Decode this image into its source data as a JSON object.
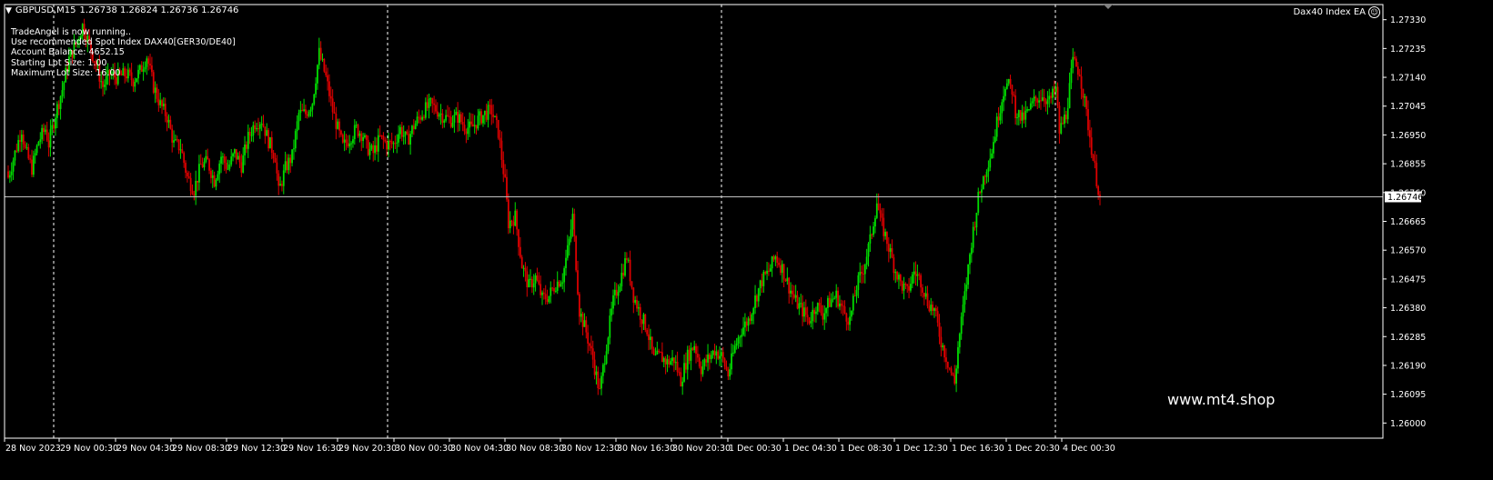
{
  "header": {
    "symbol": "GBPUSD,M15",
    "ohlc": "1.26738 1.26824 1.26736 1.26746",
    "ea_name": "Dax40 Index EA"
  },
  "info_panel": [
    "TradeAngel is now running..",
    "Use recommended Spot Index DAX40[GER30/DE40]",
    "Account Balance: 4652.15",
    "Starting Lot Size: 1.00",
    "Maximum Lot Size: 16.00"
  ],
  "watermark": "www.mt4.shop",
  "colors": {
    "background": "#000000",
    "bull": "#00dd00",
    "bear": "#dd0000",
    "grid": "#ffffff",
    "axis_text": "#ffffff",
    "price_line": "#c0c0c0"
  },
  "chart_data": {
    "type": "candlestick",
    "symbol": "GBPUSD",
    "timeframe": "M15",
    "current_price": 1.26746,
    "current_price_label": "1.26746",
    "ylim": [
      1.2595,
      1.2738
    ],
    "y_ticks": [
      "1.27330",
      "1.27235",
      "1.27140",
      "1.27045",
      "1.26950",
      "1.26855",
      "1.26760",
      "1.26665",
      "1.26570",
      "1.26475",
      "1.26380",
      "1.26285",
      "1.26190",
      "1.26095",
      "1.26000"
    ],
    "x_tick_labels": [
      "28 Nov 2023",
      "29 Nov 00:30",
      "29 Nov 04:30",
      "29 Nov 08:30",
      "29 Nov 12:30",
      "29 Nov 16:30",
      "29 Nov 20:30",
      "30 Nov 00:30",
      "30 Nov 04:30",
      "30 Nov 08:30",
      "30 Nov 12:30",
      "30 Nov 16:30",
      "30 Nov 20:30",
      "1 Dec 00:30",
      "1 Dec 04:30",
      "1 Dec 08:30",
      "1 Dec 12:30",
      "1 Dec 16:30",
      "1 Dec 20:30",
      "4 Dec 00:30"
    ],
    "day_separators": [
      "29 Nov",
      "30 Nov",
      "1 Dec",
      "4 Dec"
    ],
    "close_path": [
      [
        0,
        1.2681
      ],
      [
        4,
        1.2689
      ],
      [
        8,
        1.2697
      ],
      [
        10,
        1.269
      ],
      [
        14,
        1.2684
      ],
      [
        18,
        1.2693
      ],
      [
        22,
        1.2697
      ],
      [
        24,
        1.2692
      ],
      [
        28,
        1.2702
      ],
      [
        32,
        1.271
      ],
      [
        36,
        1.272
      ],
      [
        40,
        1.2725
      ],
      [
        44,
        1.2731
      ],
      [
        48,
        1.2725
      ],
      [
        52,
        1.2718
      ],
      [
        56,
        1.2711
      ],
      [
        60,
        1.2715
      ],
      [
        64,
        1.2714
      ],
      [
        70,
        1.2715
      ],
      [
        74,
        1.2713
      ],
      [
        78,
        1.2716
      ],
      [
        82,
        1.2721
      ],
      [
        86,
        1.2711
      ],
      [
        90,
        1.2705
      ],
      [
        94,
        1.2701
      ],
      [
        98,
        1.2692
      ],
      [
        102,
        1.2691
      ],
      [
        106,
        1.2681
      ],
      [
        110,
        1.2677
      ],
      [
        114,
        1.2685
      ],
      [
        118,
        1.2686
      ],
      [
        122,
        1.268
      ],
      [
        126,
        1.2688
      ],
      [
        130,
        1.2684
      ],
      [
        134,
        1.2689
      ],
      [
        138,
        1.2685
      ],
      [
        142,
        1.2694
      ],
      [
        146,
        1.2699
      ],
      [
        150,
        1.27
      ],
      [
        154,
        1.2693
      ],
      [
        158,
        1.2688
      ],
      [
        160,
        1.2676
      ],
      [
        164,
        1.2684
      ],
      [
        168,
        1.2688
      ],
      [
        172,
        1.2702
      ],
      [
        176,
        1.2702
      ],
      [
        180,
        1.2706
      ],
      [
        184,
        1.2722
      ],
      [
        188,
        1.2714
      ],
      [
        192,
        1.2703
      ],
      [
        196,
        1.2695
      ],
      [
        198,
        1.2691
      ],
      [
        202,
        1.2694
      ],
      [
        206,
        1.2697
      ],
      [
        210,
        1.2695
      ],
      [
        212,
        1.2691
      ],
      [
        216,
        1.2689
      ],
      [
        220,
        1.2694
      ],
      [
        224,
        1.2692
      ],
      [
        228,
        1.2692
      ],
      [
        232,
        1.2697
      ],
      [
        236,
        1.2693
      ],
      [
        240,
        1.2698
      ],
      [
        246,
        1.2703
      ],
      [
        250,
        1.2705
      ],
      [
        254,
        1.2703
      ],
      [
        258,
        1.2701
      ],
      [
        262,
        1.27
      ],
      [
        266,
        1.2701
      ],
      [
        270,
        1.2698
      ],
      [
        274,
        1.2697
      ],
      [
        278,
        1.27
      ],
      [
        282,
        1.2702
      ],
      [
        286,
        1.2703
      ],
      [
        290,
        1.2696
      ],
      [
        294,
        1.2679
      ],
      [
        296,
        1.2666
      ],
      [
        300,
        1.2668
      ],
      [
        304,
        1.2652
      ],
      [
        308,
        1.2645
      ],
      [
        312,
        1.2648
      ],
      [
        316,
        1.2641
      ],
      [
        320,
        1.2642
      ],
      [
        324,
        1.2646
      ],
      [
        328,
        1.2648
      ],
      [
        332,
        1.266
      ],
      [
        334,
        1.2668
      ],
      [
        338,
        1.2637
      ],
      [
        342,
        1.263
      ],
      [
        346,
        1.2621
      ],
      [
        350,
        1.261
      ],
      [
        354,
        1.2626
      ],
      [
        358,
        1.264
      ],
      [
        362,
        1.2647
      ],
      [
        366,
        1.2655
      ],
      [
        370,
        1.2642
      ],
      [
        374,
        1.2636
      ],
      [
        378,
        1.2631
      ],
      [
        382,
        1.2621
      ],
      [
        386,
        1.2622
      ],
      [
        390,
        1.262
      ],
      [
        394,
        1.2621
      ],
      [
        398,
        1.2614
      ],
      [
        402,
        1.2622
      ],
      [
        406,
        1.2626
      ],
      [
        410,
        1.2618
      ],
      [
        414,
        1.2621
      ],
      [
        418,
        1.2624
      ],
      [
        422,
        1.2622
      ],
      [
        426,
        1.2616
      ],
      [
        430,
        1.2625
      ],
      [
        434,
        1.2631
      ],
      [
        438,
        1.2634
      ],
      [
        442,
        1.2641
      ],
      [
        446,
        1.2647
      ],
      [
        450,
        1.265
      ],
      [
        454,
        1.2655
      ],
      [
        458,
        1.2651
      ],
      [
        462,
        1.2645
      ],
      [
        466,
        1.264
      ],
      [
        470,
        1.2637
      ],
      [
        474,
        1.2634
      ],
      [
        478,
        1.2639
      ],
      [
        482,
        1.2636
      ],
      [
        486,
        1.264
      ],
      [
        490,
        1.2642
      ],
      [
        494,
        1.2637
      ],
      [
        498,
        1.2634
      ],
      [
        502,
        1.2645
      ],
      [
        506,
        1.2651
      ],
      [
        510,
        1.266
      ],
      [
        514,
        1.2673
      ],
      [
        516,
        1.2667
      ],
      [
        520,
        1.266
      ],
      [
        524,
        1.2652
      ],
      [
        528,
        1.2646
      ],
      [
        532,
        1.2643
      ],
      [
        536,
        1.265
      ],
      [
        540,
        1.2647
      ],
      [
        544,
        1.264
      ],
      [
        548,
        1.2637
      ],
      [
        552,
        1.2627
      ],
      [
        556,
        1.262
      ],
      [
        560,
        1.2613
      ],
      [
        562,
        1.2625
      ],
      [
        566,
        1.2642
      ],
      [
        570,
        1.266
      ],
      [
        574,
        1.2674
      ],
      [
        578,
        1.2683
      ],
      [
        582,
        1.269
      ],
      [
        586,
        1.2702
      ],
      [
        590,
        1.2712
      ],
      [
        594,
        1.271
      ],
      [
        596,
        1.2703
      ],
      [
        600,
        1.27
      ],
      [
        604,
        1.2703
      ],
      [
        608,
        1.2707
      ],
      [
        612,
        1.2708
      ],
      [
        616,
        1.2706
      ],
      [
        620,
        1.271
      ],
      [
        622,
        1.2696
      ],
      [
        626,
        1.2702
      ],
      [
        630,
        1.2719
      ],
      [
        634,
        1.2716
      ],
      [
        638,
        1.2702
      ],
      [
        642,
        1.2687
      ],
      [
        646,
        1.2674
      ]
    ]
  }
}
